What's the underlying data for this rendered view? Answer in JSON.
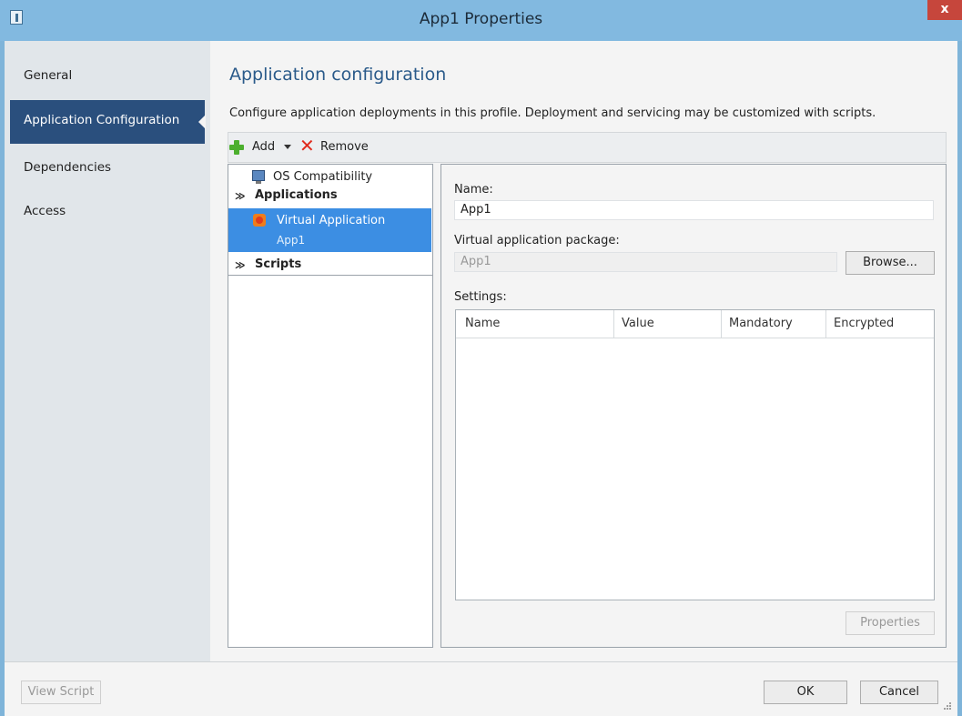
{
  "window": {
    "title": "App1 Properties",
    "close_glyph": "x"
  },
  "sidebar": {
    "items": [
      {
        "label": "General"
      },
      {
        "label": "Application Configuration",
        "selected": true
      },
      {
        "label": "Dependencies"
      },
      {
        "label": "Access"
      }
    ]
  },
  "main": {
    "heading": "Application configuration",
    "description": "Configure application deployments in this profile. Deployment and servicing may be customized with scripts."
  },
  "toolbar": {
    "add_label": "Add",
    "remove_label": "Remove",
    "add_icon": "green-plus-icon",
    "remove_icon": "red-x-icon"
  },
  "tree": {
    "os_compat": {
      "label": "OS Compatibility",
      "icon": "monitor-icon"
    },
    "groups": [
      {
        "label": "Applications",
        "chevron": "≫"
      },
      {
        "label": "Scripts",
        "chevron": "≫"
      }
    ],
    "selected_item": {
      "label": "Virtual Application",
      "sublabel": "App1",
      "icon": "virtual-app-icon"
    }
  },
  "detail": {
    "name_label": "Name:",
    "name_value": "App1",
    "package_label": "Virtual application package:",
    "package_value": "App1",
    "browse_label": "Browse...",
    "settings_label": "Settings:",
    "settings_columns": [
      "Name",
      "Value",
      "Mandatory",
      "Encrypted"
    ],
    "properties_label": "Properties"
  },
  "footer": {
    "view_script_label": "View Script",
    "ok_label": "OK",
    "cancel_label": "Cancel"
  },
  "colors": {
    "titlebar": "#82b9e0",
    "nav_selected": "#2a4f7d",
    "tree_selected": "#3c8ee3",
    "heading": "#2a5a8a",
    "close": "#c6463c"
  }
}
